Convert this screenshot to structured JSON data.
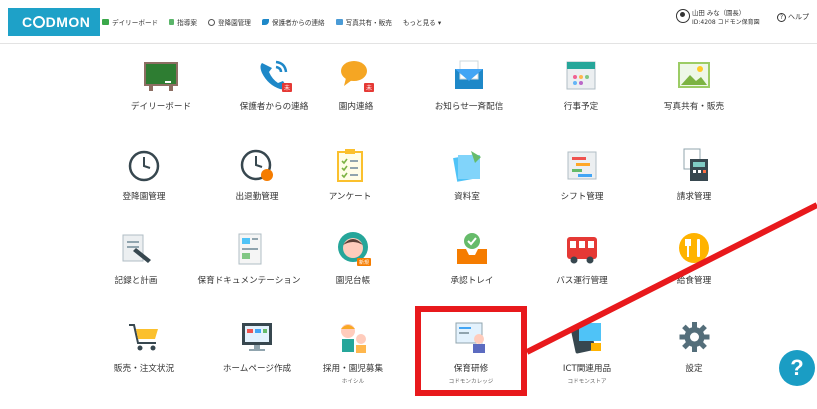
{
  "brand": {
    "logo_text": "DMON",
    "accent": "#1ea1c8"
  },
  "nav": [
    {
      "label": "デイリーボード",
      "icon": "board-icon",
      "color": "#3aa84a"
    },
    {
      "label": "指導案",
      "icon": "notebook-icon",
      "color": "#5bb56a"
    },
    {
      "label": "登降園管理",
      "icon": "clock-icon",
      "color": "#555555"
    },
    {
      "label": "保護者からの連絡",
      "icon": "phone-icon",
      "color": "#1e88c8"
    },
    {
      "label": "写真共有・販売",
      "icon": "photo-icon",
      "color": "#4a9bd6"
    },
    {
      "label": "もっと見る ▾",
      "icon": "",
      "color": ""
    }
  ],
  "user": {
    "name": "山田 みな（園長）",
    "id": "ID:4208 コドモン保育園"
  },
  "help_label": "ヘルプ",
  "tiles": [
    {
      "label": "デイリーボード",
      "icon": "chalkboard-icon"
    },
    {
      "label": "保護者からの連絡",
      "icon": "phone-icon",
      "badge": "未"
    },
    {
      "label": "園内連絡",
      "icon": "chat-bubble-icon",
      "badge": "未"
    },
    {
      "label": "お知らせ一斉配信",
      "icon": "envelope-icon"
    },
    {
      "label": "行事予定",
      "icon": "calendar-icon"
    },
    {
      "label": "写真共有・販売",
      "icon": "photo-icon"
    },
    {
      "label": "登降園管理",
      "icon": "clock-icon"
    },
    {
      "label": "出退勤管理",
      "icon": "clock-person-icon"
    },
    {
      "label": "アンケート",
      "icon": "clipboard-icon"
    },
    {
      "label": "資料室",
      "icon": "documents-icon"
    },
    {
      "label": "シフト管理",
      "icon": "shift-chart-icon"
    },
    {
      "label": "請求管理",
      "icon": "calculator-icon"
    },
    {
      "label": "記録と計画",
      "icon": "pencil-icon"
    },
    {
      "label": "保育ドキュメンテーション",
      "icon": "documentation-icon"
    },
    {
      "label": "園児台帳",
      "icon": "child-icon",
      "badge": "新規"
    },
    {
      "label": "承認トレイ",
      "icon": "approval-tray-icon"
    },
    {
      "label": "バス運行管理",
      "icon": "bus-icon"
    },
    {
      "label": "給食管理",
      "icon": "meal-icon"
    },
    {
      "label": "販売・注文状況",
      "icon": "cart-icon"
    },
    {
      "label": "ホームページ作成",
      "icon": "monitor-icon"
    },
    {
      "label": "採用・園児募集",
      "sub": "ホイシル",
      "icon": "recruit-icon"
    },
    {
      "label": "保育研修",
      "sub": "コドモンカレッジ",
      "icon": "training-icon"
    },
    {
      "label": "ICT関連用品",
      "sub": "コドモンストア",
      "icon": "tablet-icon"
    },
    {
      "label": "設定",
      "icon": "gear-icon"
    }
  ],
  "fab_label": "?"
}
